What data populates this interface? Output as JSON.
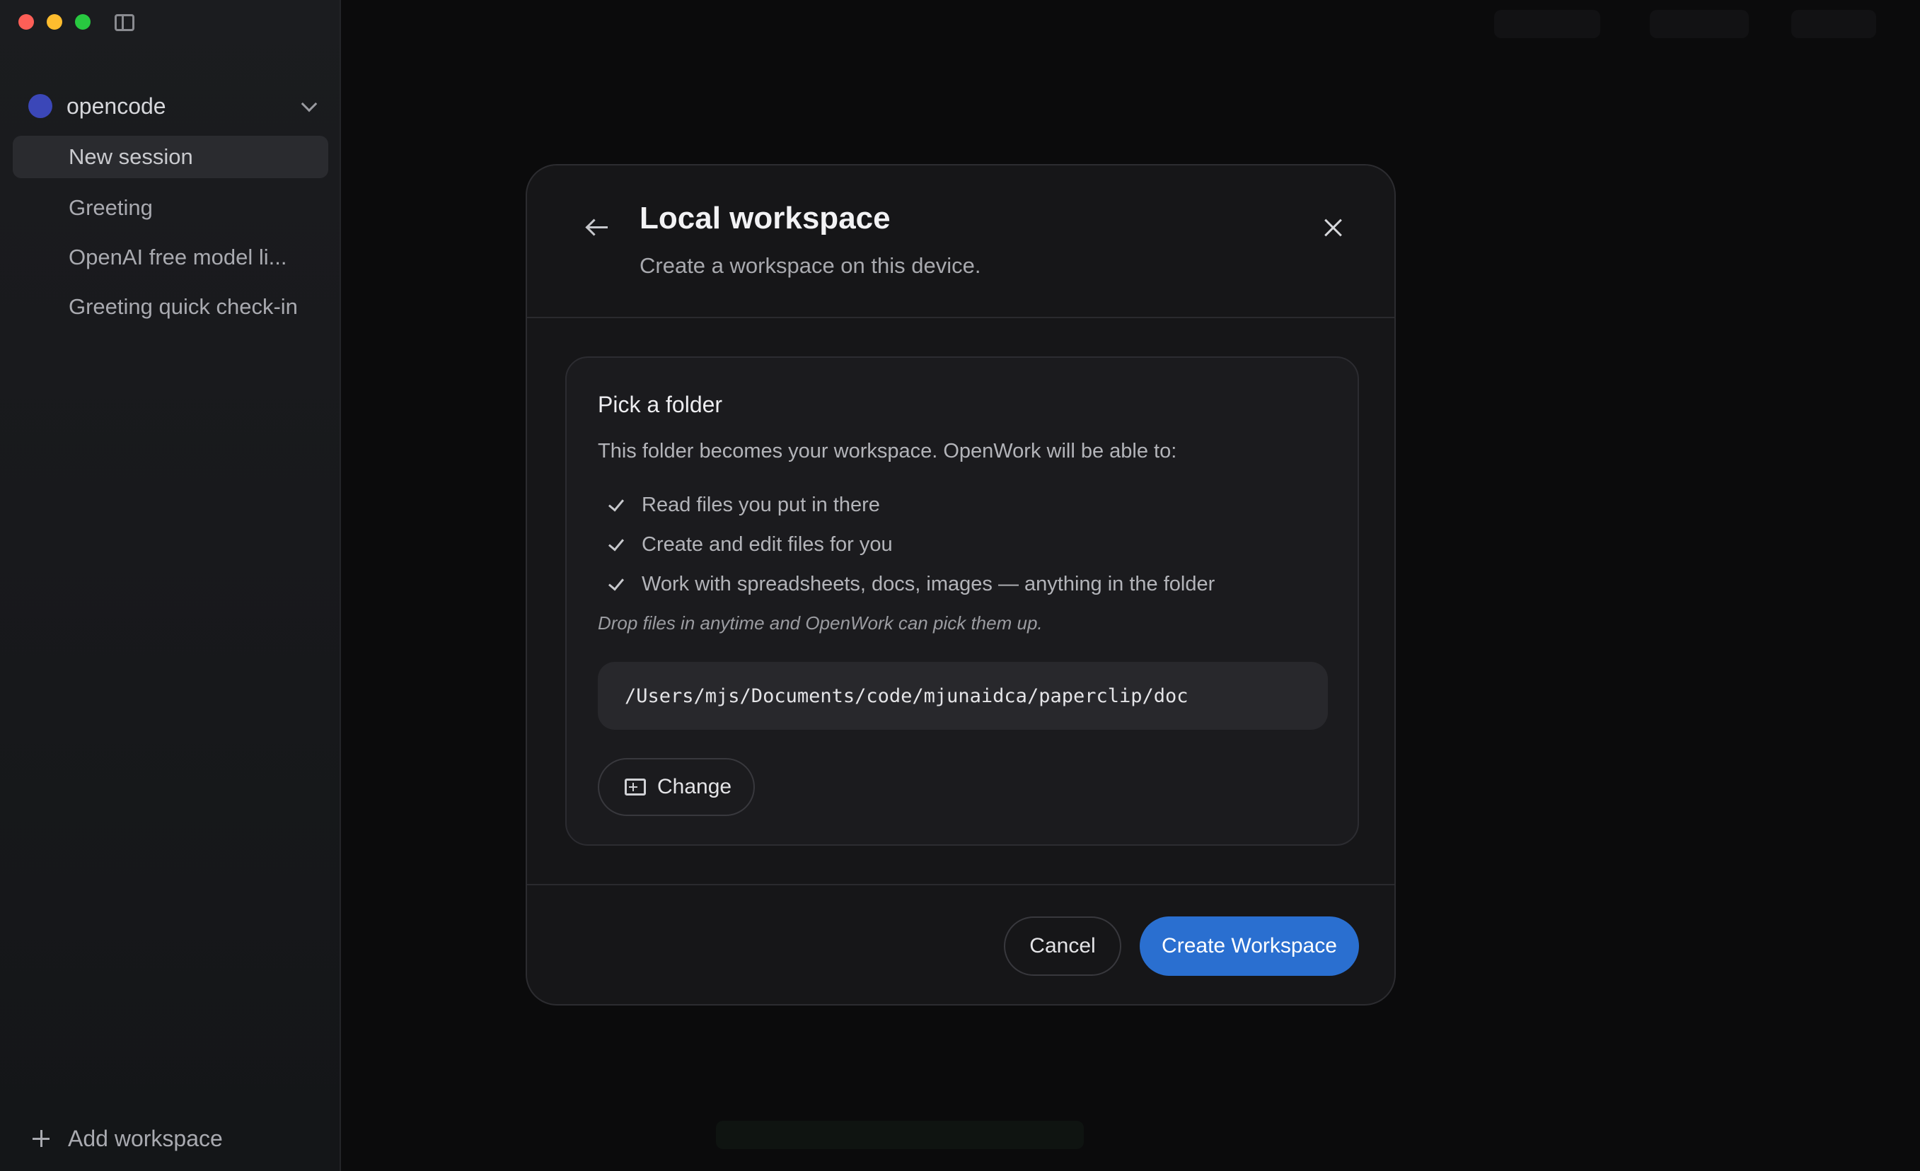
{
  "sidebar": {
    "workspace": {
      "name": "opencode",
      "dot_color": "#3b47b8"
    },
    "sessions": [
      {
        "label": "New session",
        "active": true
      },
      {
        "label": "Greeting",
        "active": false
      },
      {
        "label": "OpenAI free model li...",
        "active": false
      },
      {
        "label": "Greeting quick check-in",
        "active": false
      }
    ],
    "add_workspace_label": "Add workspace"
  },
  "modal": {
    "title": "Local workspace",
    "subtitle": "Create a workspace on this device.",
    "card": {
      "title": "Pick a folder",
      "description": "This folder becomes your workspace. OpenWork will be able to:",
      "capabilities": [
        "Read files you put in there",
        "Create and edit files for you",
        "Work with spreadsheets, docs, images — anything in the folder"
      ],
      "note": "Drop files in anytime and OpenWork can pick them up.",
      "folder_path": "/Users/mjs/Documents/code/mjunaidca/paperclip/doc",
      "change_label": "Change"
    },
    "cancel_label": "Cancel",
    "create_label": "Create Workspace"
  },
  "colors": {
    "accent": "#2a6fd0",
    "traffic_red": "#fe5f57",
    "traffic_yellow": "#febc2e",
    "traffic_green": "#28c840"
  },
  "icons": {
    "sidebar_toggle": "sidebar-toggle-icon",
    "workspace_chevron": "chevron-down-icon",
    "add": "plus-icon",
    "back": "arrow-left-icon",
    "close": "close-icon",
    "check": "check-icon",
    "folder": "folder-plus-icon"
  }
}
